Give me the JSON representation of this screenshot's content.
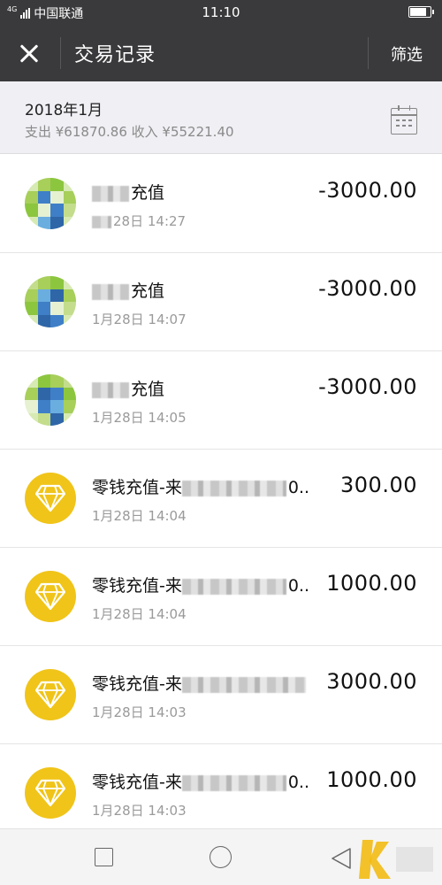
{
  "status_bar": {
    "network": "4G",
    "carrier": "中国联通",
    "time": "11:10",
    "battery_level": 0.85
  },
  "header": {
    "title": "交易记录",
    "filter_label": "筛选"
  },
  "summary": {
    "month": "2018年1月",
    "totals": "支出 ¥61870.86 收入 ¥55221.40"
  },
  "transactions": [
    {
      "icon": "mosaic-avatar",
      "name_suffix": "充值",
      "time": "28日 14:27",
      "amount": "-3000.00"
    },
    {
      "icon": "mosaic-avatar",
      "name_suffix": "充值",
      "time": "1月28日 14:07",
      "amount": "-3000.00"
    },
    {
      "icon": "mosaic-avatar",
      "name_suffix": "充值",
      "time": "1月28日 14:05",
      "amount": "-3000.00"
    },
    {
      "icon": "diamond-icon",
      "name": "零钱充值-来",
      "name_tail": "0..",
      "time": "1月28日 14:04",
      "amount": "300.00"
    },
    {
      "icon": "diamond-icon",
      "name": "零钱充值-来",
      "name_tail": "0..",
      "time": "1月28日 14:04",
      "amount": "1000.00"
    },
    {
      "icon": "diamond-icon",
      "name": "零钱充值-来",
      "name_tail": "",
      "time": "1月28日 14:03",
      "amount": "3000.00"
    },
    {
      "icon": "diamond-icon",
      "name": "零钱充值-来",
      "name_tail": "0..",
      "time": "1月28日 14:03",
      "amount": "1000.00"
    }
  ],
  "colors": {
    "header_bg": "#3a3a3c",
    "summary_bg": "#efeff4",
    "diamond_yellow": "#f0c419",
    "amount_text": "#111111"
  }
}
